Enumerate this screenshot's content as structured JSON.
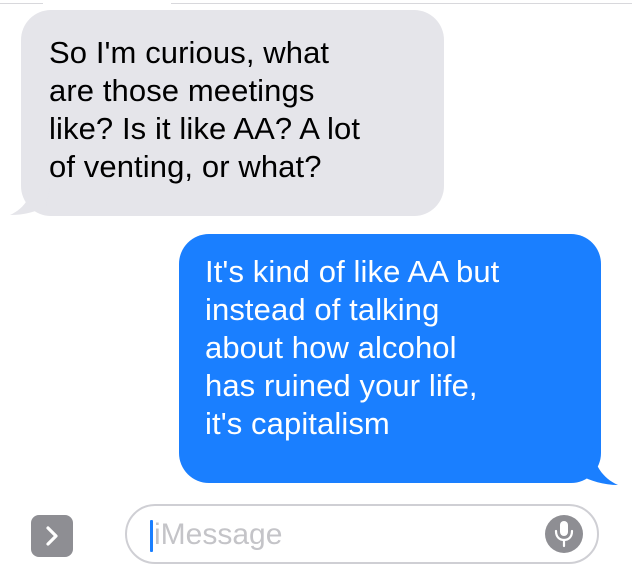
{
  "conversation": {
    "messages": [
      {
        "direction": "incoming",
        "text": "So I'm curious, what\nare those meetings\nlike? Is it like AA? A lot\nof venting, or what?"
      },
      {
        "direction": "outgoing",
        "text": "It's kind of like AA but\ninstead of talking\nabout how alcohol\nhas ruined your life,\nit's capitalism"
      }
    ]
  },
  "composer": {
    "placeholder": "iMessage",
    "expand_icon": "chevron-right-icon",
    "mic_icon": "microphone-icon"
  },
  "colors": {
    "incoming_bubble": "#e5e5ea",
    "outgoing_bubble": "#1a7fff",
    "accent": "#1a7fff",
    "icon_gray": "#8e8e93"
  }
}
